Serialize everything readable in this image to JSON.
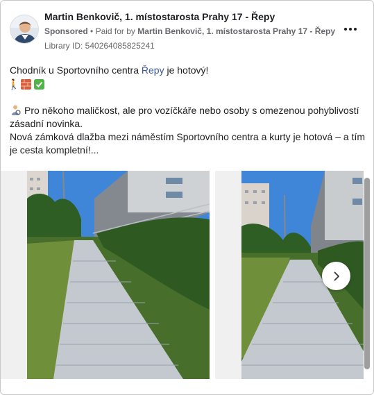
{
  "post": {
    "author": "Martin Benkovič, 1. místostarosta Prahy 17 - Řepy",
    "sponsored": "Sponsored",
    "separator": "•",
    "paid_for_prefix": "Paid for by",
    "paid_for_name": "Martin Benkovič, 1. místostarosta Prahy 17 - Řepy",
    "library_id": "Library ID: 540264085825241"
  },
  "body": {
    "line1_before": "Chodník u Sportovního centra ",
    "line1_link": "Řepy",
    "line1_after": " je hotový!",
    "line2": "Pro někoho maličkost, ale pro vozíčkáře nebo osoby s omezenou pohyblivostí zásadní novinka.",
    "line3": "Nová zámková dlažba mezi náměstím Sportovního centra a kurty je hotová – a tím je cesta kompletní!..."
  },
  "icons": {
    "more": "more-options-icon",
    "walk": "person-walking-emoji",
    "brick": "brick-emoji",
    "check": "check-mark-emoji",
    "wheelchair": "wheelchair-user-emoji",
    "next": "chevron-right-icon"
  },
  "colors": {
    "link": "#385898",
    "secondary_text": "#65676b",
    "sky": "#3f86d9"
  }
}
